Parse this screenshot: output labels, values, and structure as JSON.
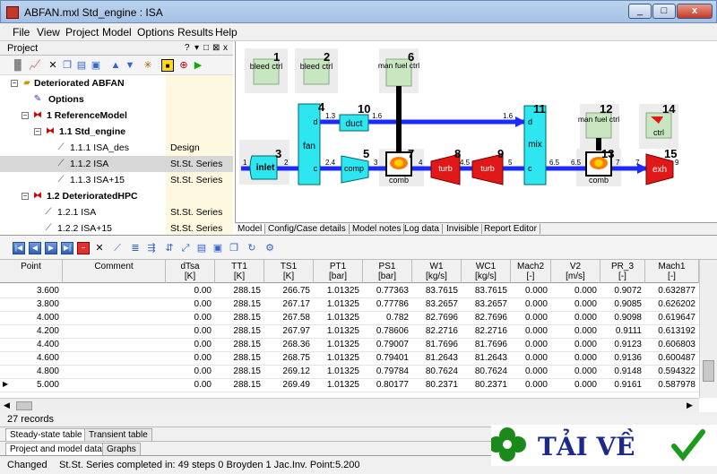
{
  "window": {
    "title": "ABFAN.mxl      Std_engine : ISA",
    "min": "_",
    "max": "□",
    "close": "x"
  },
  "menu": [
    "File",
    "View",
    "Project",
    "Model",
    "Options",
    "Results",
    "Help"
  ],
  "project_panel": {
    "title": "Project",
    "controls": [
      "?",
      "▾",
      "□",
      "⊠",
      "x"
    ],
    "tree": [
      {
        "label": "Deteriorated ABFAN",
        "tag": ""
      },
      {
        "label": "Options",
        "tag": ""
      },
      {
        "label": "1 ReferenceModel",
        "tag": ""
      },
      {
        "label": "1.1 Std_engine",
        "tag": ""
      },
      {
        "label": "1.1.1 ISA_des",
        "tag": "Design"
      },
      {
        "label": "1.1.2 ISA",
        "tag": "St.St. Series"
      },
      {
        "label": "1.1.3 ISA+15",
        "tag": "St.St. Series"
      },
      {
        "label": "1.2 DeterioratedHPC",
        "tag": ""
      },
      {
        "label": "1.2.1 ISA",
        "tag": "St.St. Series"
      },
      {
        "label": "1.2.2 ISA+15",
        "tag": "St.St. Series"
      }
    ]
  },
  "diagram": {
    "components": {
      "bleed1": "bleed ctrl",
      "bleed2": "bleed ctrl",
      "fuel6": "man fuel ctrl",
      "fuel12": "man fuel ctrl",
      "ctrl14": "ctrl",
      "inlet": "inlet",
      "fan": "fan",
      "duct": "duct",
      "comp": "comp",
      "comb7": "comb",
      "turb8": "turb",
      "turb9": "turb",
      "mix": "mix",
      "comb13": "comb",
      "exh": "exh",
      "fan_d": "d",
      "fan_c": "c",
      "mix_d": "d",
      "mix_c": "c"
    },
    "numbers": [
      "1",
      "2",
      "3",
      "4",
      "5",
      "6",
      "7",
      "8",
      "9",
      "10",
      "11",
      "12",
      "13",
      "14",
      "15"
    ],
    "station_labels": [
      "1",
      "2",
      "1.3",
      "1.6",
      "1.6",
      "2.4",
      "3",
      "4",
      "4.5",
      "5",
      "6.5",
      "6.5",
      "7",
      "7",
      "9"
    ]
  },
  "diagram_tabs": [
    "Model",
    "Config/Case details",
    "Model notes",
    "Log data",
    "Invisible",
    "Report Editor"
  ],
  "grid": {
    "columns": [
      {
        "name": "Point",
        "unit": ""
      },
      {
        "name": "Comment",
        "unit": ""
      },
      {
        "name": "dTsa",
        "unit": "[K]"
      },
      {
        "name": "TT1",
        "unit": "[K]"
      },
      {
        "name": "TS1",
        "unit": "[K]"
      },
      {
        "name": "PT1",
        "unit": "[bar]"
      },
      {
        "name": "PS1",
        "unit": "[bar]"
      },
      {
        "name": "W1",
        "unit": "[kg/s]"
      },
      {
        "name": "WC1",
        "unit": "[kg/s]"
      },
      {
        "name": "Mach2",
        "unit": "[-]"
      },
      {
        "name": "V2",
        "unit": "[m/s]"
      },
      {
        "name": "PR_3",
        "unit": "[-]"
      },
      {
        "name": "Mach1",
        "unit": "[-]"
      }
    ],
    "rows": [
      [
        "3.600",
        "",
        "0.00",
        "288.15",
        "266.75",
        "1.01325",
        "0.77363",
        "83.7615",
        "83.7615",
        "0.000",
        "0.000",
        "0.9072",
        "0.632877"
      ],
      [
        "3.800",
        "",
        "0.00",
        "288.15",
        "267.17",
        "1.01325",
        "0.77786",
        "83.2657",
        "83.2657",
        "0.000",
        "0.000",
        "0.9085",
        "0.626202"
      ],
      [
        "4.000",
        "",
        "0.00",
        "288.15",
        "267.58",
        "1.01325",
        "0.782",
        "82.7696",
        "82.7696",
        "0.000",
        "0.000",
        "0.9098",
        "0.619647"
      ],
      [
        "4.200",
        "",
        "0.00",
        "288.15",
        "267.97",
        "1.01325",
        "0.78606",
        "82.2716",
        "82.2716",
        "0.000",
        "0.000",
        "0.9111",
        "0.613192"
      ],
      [
        "4.400",
        "",
        "0.00",
        "288.15",
        "268.36",
        "1.01325",
        "0.79007",
        "81.7696",
        "81.7696",
        "0.000",
        "0.000",
        "0.9123",
        "0.606803"
      ],
      [
        "4.600",
        "",
        "0.00",
        "288.15",
        "268.75",
        "1.01325",
        "0.79401",
        "81.2643",
        "81.2643",
        "0.000",
        "0.000",
        "0.9136",
        "0.600487"
      ],
      [
        "4.800",
        "",
        "0.00",
        "288.15",
        "269.12",
        "1.01325",
        "0.79784",
        "80.7624",
        "80.7624",
        "0.000",
        "0.000",
        "0.9148",
        "0.594322"
      ],
      [
        "5.000",
        "",
        "0.00",
        "288.15",
        "269.49",
        "1.01325",
        "0.80177",
        "80.2371",
        "80.2371",
        "0.000",
        "0.000",
        "0.9161",
        "0.587978"
      ]
    ],
    "current_row_marker": "▶"
  },
  "records": "27  records",
  "bottom_tabs_1": [
    "Steady-state table",
    "Transient table"
  ],
  "bottom_tabs_2": [
    "Project and model data",
    "Graphs"
  ],
  "status": {
    "state": "Changed",
    "message": "St.St. Series completed in: 49 steps  0 Broyden  1 Jac.Inv. Point:5.200"
  },
  "logo": {
    "text": "TẢI VỀ"
  },
  "colors": {
    "flow": "#1b2bff",
    "component_cyan": "#2ee6f0",
    "component_red": "#e01818",
    "ctrl_green": "#c8e6c0",
    "bar_black": "#000000"
  }
}
